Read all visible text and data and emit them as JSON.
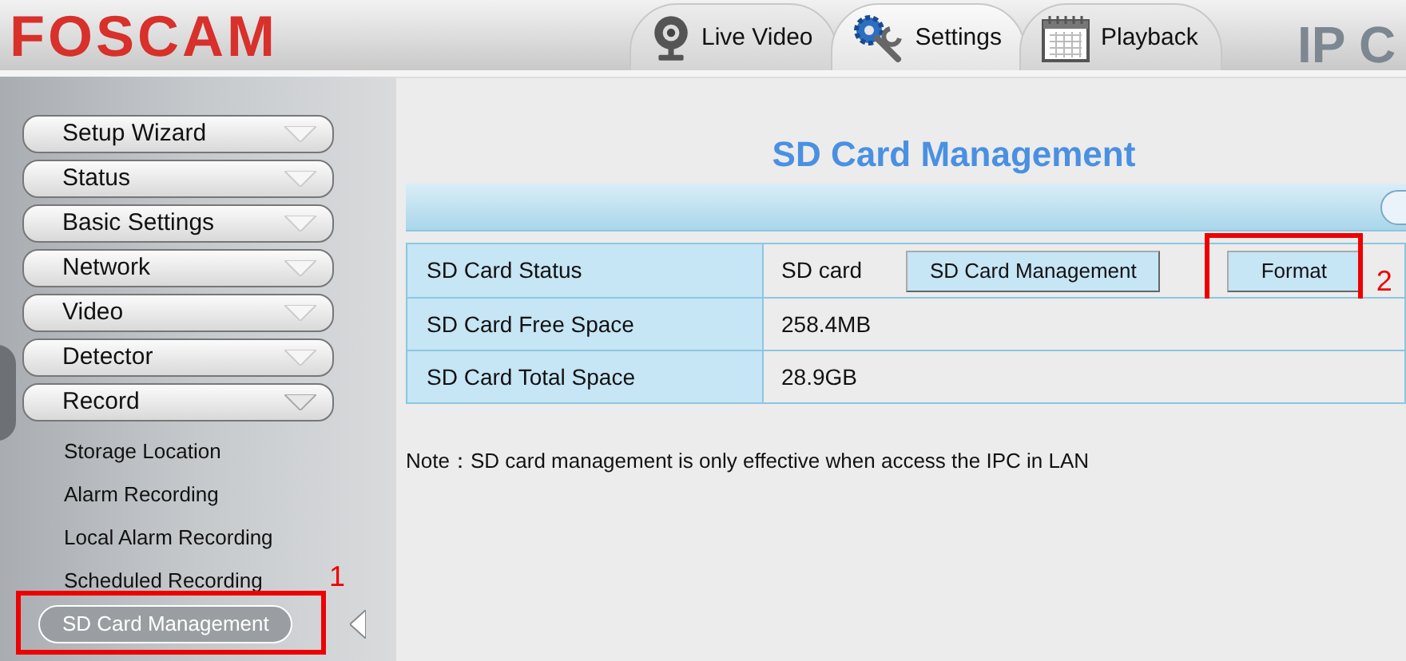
{
  "header": {
    "logo": "FOSCAM",
    "title_fragment": "IP C"
  },
  "tabs": [
    {
      "label": "Live Video",
      "selected": false
    },
    {
      "label": "Settings",
      "selected": true
    },
    {
      "label": "Playback",
      "selected": false
    }
  ],
  "sidebar": {
    "items": [
      {
        "label": "Setup Wizard",
        "expanded": false
      },
      {
        "label": "Status",
        "expanded": false
      },
      {
        "label": "Basic Settings",
        "expanded": false
      },
      {
        "label": "Network",
        "expanded": false
      },
      {
        "label": "Video",
        "expanded": false
      },
      {
        "label": "Detector",
        "expanded": false
      },
      {
        "label": "Record",
        "expanded": true,
        "children": [
          {
            "label": "Storage Location",
            "selected": false
          },
          {
            "label": "Alarm Recording",
            "selected": false
          },
          {
            "label": "Local Alarm Recording",
            "selected": false
          },
          {
            "label": "Scheduled Recording",
            "selected": false
          },
          {
            "label": "SD Card Management",
            "selected": true
          }
        ]
      }
    ]
  },
  "page": {
    "title": "SD Card Management",
    "rows": [
      {
        "label": "SD Card Status",
        "value": "SD card",
        "buttons": [
          "SD Card Management",
          "Format"
        ]
      },
      {
        "label": "SD Card Free Space",
        "value": "258.4MB"
      },
      {
        "label": "SD Card Total Space",
        "value": "28.9GB"
      }
    ],
    "note": "Note：SD card management is only effective when access the IPC in LAN"
  },
  "annotations": [
    {
      "label": "1"
    },
    {
      "label": "2"
    }
  ]
}
